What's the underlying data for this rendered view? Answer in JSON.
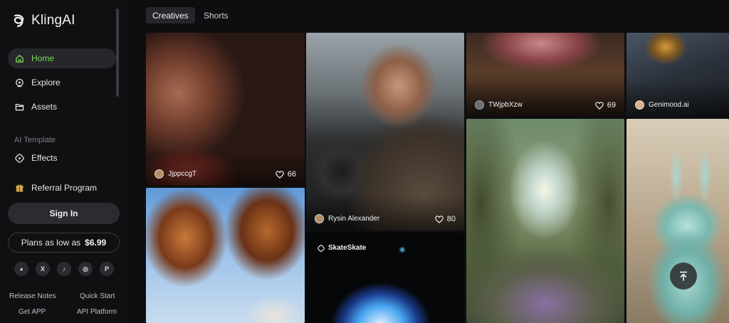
{
  "brand": {
    "name": "KlingAI"
  },
  "sidebar": {
    "nav": [
      {
        "label": "Home",
        "icon": "home-icon",
        "active": true
      },
      {
        "label": "Explore",
        "icon": "compass-icon",
        "active": false
      },
      {
        "label": "Assets",
        "icon": "folder-icon",
        "active": false
      }
    ],
    "section_label": "AI Template",
    "effects": {
      "label": "Effects",
      "icon": "sparkle-icon"
    },
    "referral": {
      "label": "Referral Program",
      "icon": "gift-icon"
    },
    "sign_in_label": "Sign In",
    "plans": {
      "label": "Plans as low as",
      "price": "$6.99"
    },
    "socials": [
      {
        "name": "discord-icon",
        "glyph": "◕"
      },
      {
        "name": "x-icon",
        "glyph": "X"
      },
      {
        "name": "tiktok-icon",
        "glyph": "♪"
      },
      {
        "name": "instagram-icon",
        "glyph": "◎"
      },
      {
        "name": "pinterest-icon",
        "glyph": "P"
      }
    ],
    "footer": {
      "release_notes": "Release Notes",
      "quick_start": "Quick Start",
      "get_app": "Get APP",
      "api_platform": "API Platform"
    }
  },
  "tabs": [
    {
      "label": "Creatives",
      "active": true
    },
    {
      "label": "Shorts",
      "active": false
    }
  ],
  "cards": {
    "flower_lips": {
      "author": "JjppccgT",
      "likes": "66"
    },
    "driver": {
      "author": "Rysin Alexander",
      "likes": "80"
    },
    "steak": {
      "author": "TWjpbXzw",
      "likes": "69"
    },
    "city": {
      "author": "Genimood.ai"
    },
    "skate": {
      "author": "SkateSkate"
    }
  },
  "colors": {
    "accent": "#7ed957",
    "background": "#0d0e10"
  }
}
